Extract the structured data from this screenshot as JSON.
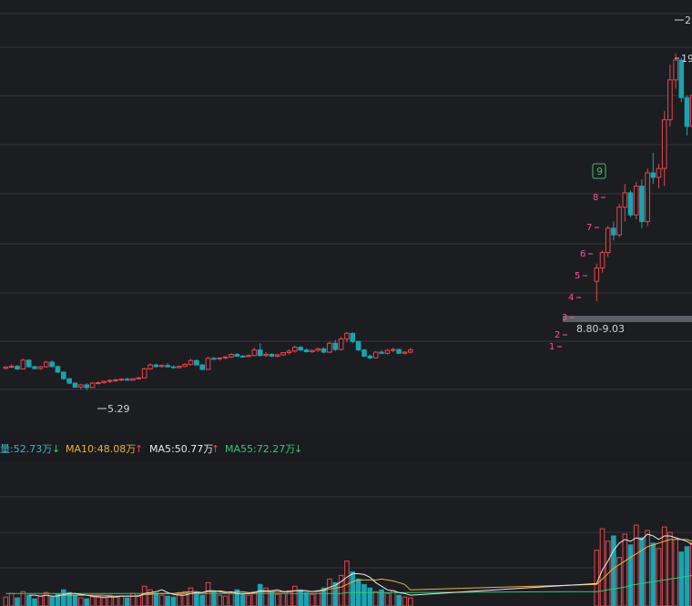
{
  "chart_data": {
    "type": "candlestick",
    "colors": {
      "background": "#1c1d21",
      "grid": "#35373d",
      "up": "#e2474e",
      "down": "#1aa3b1",
      "label": "#cfd3da",
      "tdCount": "#ff4fa3",
      "tdNine": "#35c46a",
      "ma5": "#e8e8e8",
      "ma10": "#e8b33a",
      "ma55": "#2ecc71",
      "volLabel": "#3fb6c9",
      "band": "#5c5f66",
      "arrowDown": "#2ecc71",
      "arrowUp": "#e2474e"
    },
    "price_annotations": {
      "low_label": "5.29",
      "band_label": "8.80-9.03",
      "high_label_1": "2",
      "high_label_2": "19"
    },
    "td_sequence": [
      "1",
      "2",
      "3",
      "4",
      "5",
      "6",
      "7",
      "8",
      "9"
    ],
    "volume_legend": {
      "vol": "量:52.73万",
      "ma10": "MA10:48.08万",
      "ma5": "MA5:50.77万",
      "ma55": "MA55:72.27万"
    },
    "ylim_price": [
      4.0,
      22.5
    ],
    "candles": [
      [
        6.27,
        6.36,
        6.22,
        6.33
      ],
      [
        6.33,
        6.45,
        6.28,
        6.36
      ],
      [
        6.36,
        6.42,
        6.2,
        6.24
      ],
      [
        6.24,
        6.7,
        6.22,
        6.64
      ],
      [
        6.64,
        6.66,
        6.3,
        6.34
      ],
      [
        6.34,
        6.4,
        6.22,
        6.26
      ],
      [
        6.26,
        6.38,
        6.2,
        6.34
      ],
      [
        6.34,
        6.6,
        6.3,
        6.55
      ],
      [
        6.55,
        6.62,
        6.3,
        6.35
      ],
      [
        6.35,
        6.4,
        6.05,
        6.1
      ],
      [
        6.1,
        6.12,
        5.75,
        5.8
      ],
      [
        5.8,
        5.82,
        5.55,
        5.6
      ],
      [
        5.6,
        5.62,
        5.38,
        5.42
      ],
      [
        5.42,
        5.58,
        5.32,
        5.52
      ],
      [
        5.52,
        5.6,
        5.29,
        5.4
      ],
      [
        5.4,
        5.65,
        5.38,
        5.6
      ],
      [
        5.6,
        5.68,
        5.55,
        5.62
      ],
      [
        5.62,
        5.72,
        5.58,
        5.68
      ],
      [
        5.68,
        5.78,
        5.6,
        5.72
      ],
      [
        5.72,
        5.8,
        5.65,
        5.75
      ],
      [
        5.75,
        5.82,
        5.7,
        5.78
      ],
      [
        5.78,
        5.85,
        5.72,
        5.74
      ],
      [
        5.74,
        5.82,
        5.7,
        5.8
      ],
      [
        5.8,
        5.88,
        5.76,
        5.84
      ],
      [
        5.84,
        6.3,
        5.82,
        6.25
      ],
      [
        6.25,
        6.5,
        6.2,
        6.42
      ],
      [
        6.42,
        6.48,
        6.3,
        6.35
      ],
      [
        6.35,
        6.45,
        6.3,
        6.4
      ],
      [
        6.4,
        6.5,
        6.3,
        6.34
      ],
      [
        6.34,
        6.4,
        6.25,
        6.3
      ],
      [
        6.3,
        6.4,
        6.26,
        6.36
      ],
      [
        6.36,
        6.5,
        6.32,
        6.45
      ],
      [
        6.45,
        6.7,
        6.4,
        6.62
      ],
      [
        6.62,
        6.68,
        6.4,
        6.42
      ],
      [
        6.42,
        6.46,
        6.18,
        6.22
      ],
      [
        6.22,
        6.8,
        6.2,
        6.72
      ],
      [
        6.72,
        6.78,
        6.65,
        6.7
      ],
      [
        6.7,
        6.76,
        6.62,
        6.74
      ],
      [
        6.74,
        6.82,
        6.68,
        6.78
      ],
      [
        6.78,
        6.95,
        6.74,
        6.9
      ],
      [
        6.9,
        6.96,
        6.8,
        6.82
      ],
      [
        6.82,
        6.88,
        6.76,
        6.8
      ],
      [
        6.8,
        6.9,
        6.78,
        6.85
      ],
      [
        6.85,
        7.2,
        6.82,
        7.1
      ],
      [
        7.1,
        7.4,
        6.8,
        6.85
      ],
      [
        6.85,
        7.0,
        6.78,
        6.9
      ],
      [
        6.9,
        6.95,
        6.78,
        6.82
      ],
      [
        6.82,
        6.92,
        6.76,
        6.88
      ],
      [
        6.88,
        7.0,
        6.84,
        6.98
      ],
      [
        6.98,
        7.12,
        6.9,
        7.05
      ],
      [
        7.05,
        7.3,
        6.98,
        7.22
      ],
      [
        7.22,
        7.28,
        7.05,
        7.1
      ],
      [
        7.1,
        7.16,
        6.98,
        7.02
      ],
      [
        7.02,
        7.12,
        6.96,
        7.08
      ],
      [
        7.08,
        7.2,
        7.02,
        7.15
      ],
      [
        7.15,
        7.22,
        6.95,
        7.0
      ],
      [
        7.0,
        7.48,
        6.96,
        7.4
      ],
      [
        7.4,
        7.55,
        7.05,
        7.12
      ],
      [
        7.12,
        7.7,
        7.08,
        7.6
      ],
      [
        7.6,
        7.92,
        7.45,
        7.85
      ],
      [
        7.85,
        7.9,
        7.4,
        7.48
      ],
      [
        7.48,
        7.52,
        7.06,
        7.1
      ],
      [
        7.1,
        7.14,
        6.78,
        6.82
      ],
      [
        6.82,
        6.9,
        6.68,
        6.74
      ],
      [
        6.74,
        7.05,
        6.72,
        7.0
      ],
      [
        7.0,
        7.1,
        6.9,
        6.95
      ],
      [
        6.95,
        7.14,
        6.9,
        7.08
      ],
      [
        7.08,
        7.2,
        7.0,
        7.12
      ],
      [
        7.12,
        7.16,
        6.92,
        6.95
      ],
      [
        6.95,
        7.05,
        6.9,
        7.0
      ],
      [
        7.0,
        7.2,
        6.95,
        7.1
      ],
      [
        10.2,
        11.0,
        9.3,
        10.8
      ],
      [
        10.8,
        11.6,
        10.6,
        11.5
      ],
      [
        11.5,
        12.7,
        11.3,
        12.6
      ],
      [
        12.6,
        12.9,
        12.05,
        12.3
      ],
      [
        12.3,
        13.7,
        12.2,
        13.55
      ],
      [
        13.55,
        14.6,
        12.9,
        14.2
      ],
      [
        14.2,
        14.3,
        13.1,
        13.2
      ],
      [
        13.2,
        14.7,
        13.0,
        14.5
      ],
      [
        14.5,
        14.8,
        12.6,
        12.9
      ],
      [
        12.9,
        15.3,
        12.7,
        15.1
      ],
      [
        15.1,
        16.0,
        14.6,
        14.9
      ],
      [
        14.9,
        15.5,
        14.4,
        15.3
      ],
      [
        15.3,
        17.9,
        14.5,
        17.5
      ],
      [
        17.5,
        20.0,
        17.2,
        19.3
      ],
      [
        19.3,
        20.5,
        18.9,
        20.2
      ],
      [
        20.2,
        20.3,
        18.3,
        18.5
      ],
      [
        18.5,
        18.6,
        16.8,
        17.2
      ],
      [
        17.2,
        18.9,
        16.9,
        18.6
      ]
    ],
    "volumes": [
      10,
      14,
      9,
      16,
      12,
      8,
      11,
      15,
      10,
      13,
      18,
      15,
      12,
      9,
      8,
      10,
      11,
      9,
      12,
      10,
      11,
      9,
      14,
      12,
      22,
      18,
      14,
      12,
      11,
      10,
      13,
      16,
      20,
      14,
      12,
      26,
      15,
      12,
      11,
      14,
      18,
      13,
      12,
      16,
      24,
      20,
      15,
      13,
      14,
      17,
      22,
      18,
      15,
      13,
      16,
      20,
      30,
      26,
      34,
      50,
      38,
      30,
      24,
      20,
      16,
      18,
      14,
      17,
      12,
      10,
      9,
      62,
      86,
      72,
      78,
      54,
      80,
      68,
      90,
      76,
      84,
      70,
      64,
      88,
      82,
      74,
      60,
      66,
      70
    ],
    "ma5_volume": [
      null,
      null,
      null,
      null,
      12,
      12,
      11,
      12,
      11,
      11,
      13,
      14,
      14,
      13,
      12,
      11,
      10,
      10,
      10,
      10,
      11,
      11,
      11,
      11,
      14,
      15,
      16,
      18,
      15,
      13,
      12,
      12,
      14,
      15,
      15,
      17,
      17,
      16,
      15,
      16,
      14,
      14,
      14,
      15,
      17,
      17,
      17,
      18,
      16,
      16,
      17,
      17,
      17,
      16,
      17,
      18,
      21,
      23,
      27,
      32,
      36,
      36,
      35,
      32,
      26,
      22,
      18,
      17,
      15,
      14,
      12,
      25,
      40,
      50,
      62,
      70,
      74,
      72,
      76,
      74,
      80,
      78,
      74,
      78,
      78,
      76,
      74,
      72,
      68
    ],
    "ma10_volume": [
      null,
      null,
      null,
      null,
      null,
      null,
      null,
      null,
      null,
      12,
      12,
      12,
      12,
      12,
      12,
      12,
      12,
      12,
      11,
      11,
      11,
      11,
      11,
      11,
      13,
      13,
      14,
      14,
      14,
      14,
      15,
      15,
      16,
      16,
      15,
      16,
      16,
      17,
      16,
      15,
      16,
      16,
      15,
      15,
      16,
      16,
      16,
      16,
      16,
      16,
      17,
      17,
      17,
      16,
      17,
      17,
      19,
      20,
      21,
      24,
      27,
      29,
      29,
      29,
      29,
      30,
      29,
      28,
      26,
      24,
      18,
      24,
      30,
      36,
      42,
      46,
      50,
      54,
      58,
      62,
      66,
      68,
      70,
      72,
      74,
      74,
      74,
      74,
      72
    ],
    "ma55_volume": [
      14,
      14,
      14,
      14,
      14,
      14,
      14,
      14,
      14,
      14,
      14,
      14,
      14,
      14,
      14,
      14,
      14,
      14,
      14,
      14,
      14,
      14,
      14,
      14,
      14,
      14,
      14,
      14,
      14,
      14,
      14,
      14,
      14,
      14,
      14,
      14,
      14,
      14,
      14,
      14,
      14,
      14,
      14,
      14,
      14,
      14,
      14,
      14,
      14,
      14,
      14,
      14,
      14,
      14,
      14,
      14,
      14,
      14,
      14,
      15,
      15,
      15,
      15,
      15,
      15,
      15,
      15,
      15,
      15,
      15,
      15,
      16,
      17,
      18,
      19,
      20,
      21,
      23,
      24,
      25,
      26,
      27,
      28,
      29,
      30,
      31,
      32,
      33,
      34
    ]
  }
}
